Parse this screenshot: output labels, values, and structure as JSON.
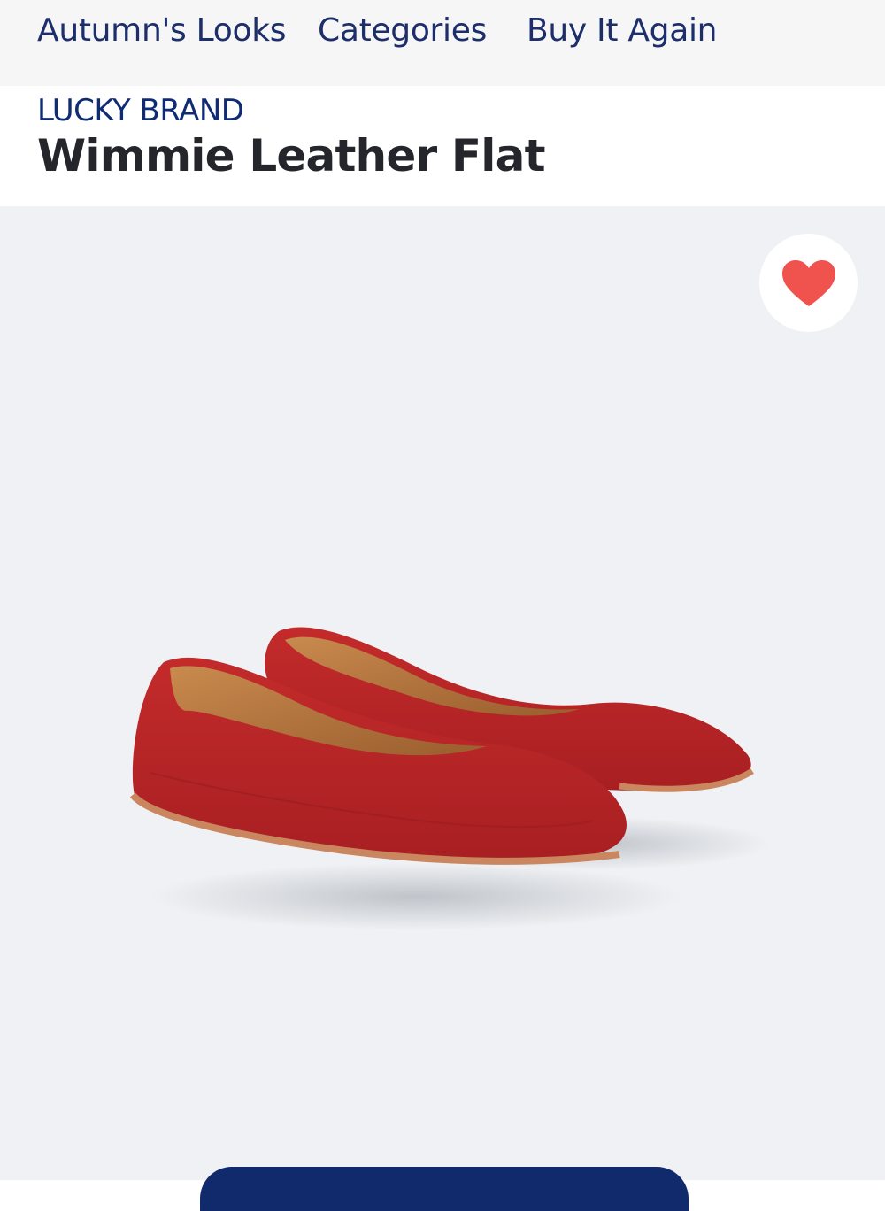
{
  "nav": {
    "links": [
      "Autumn's Looks",
      "Categories",
      "Buy It Again"
    ]
  },
  "product": {
    "brand": "LUCKY BRAND",
    "title": "Wimmie Leather Flat",
    "image_alt": "Red leather ballet flats",
    "favorited": true
  },
  "icons": {
    "favorite": "heart-icon"
  },
  "colors": {
    "nav_text": "#1d2f6b",
    "brand_text": "#0f2b75",
    "title_text": "#24262b",
    "favorite_heart": "#f0524d",
    "product_color": "#b82424",
    "cta_background": "#102a6c"
  }
}
